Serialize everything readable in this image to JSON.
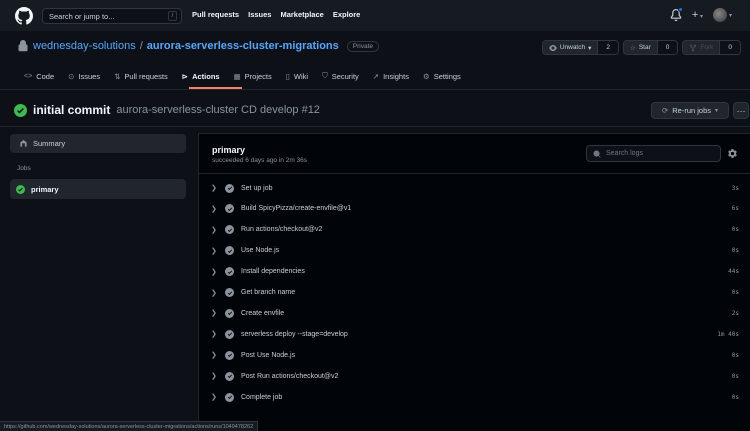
{
  "topbar": {
    "search_placeholder": "Search or jump to...",
    "search_shortcut": "/",
    "nav": [
      "Pull requests",
      "Issues",
      "Marketplace",
      "Explore"
    ]
  },
  "repo": {
    "owner": "wednesday-solutions",
    "separator": "/",
    "name": "aurora-serverless-cluster-migrations",
    "visibility": "Private",
    "unwatch_label": "Unwatch",
    "unwatch_count": "2",
    "star_label": "Star",
    "star_count": "0",
    "fork_label": "Fork",
    "fork_count": "0"
  },
  "tabs": [
    {
      "label": "Code",
      "icon": "code-icon"
    },
    {
      "label": "Issues",
      "icon": "issue-icon"
    },
    {
      "label": "Pull requests",
      "icon": "pull-request-icon"
    },
    {
      "label": "Actions",
      "icon": "play-icon"
    },
    {
      "label": "Projects",
      "icon": "project-icon"
    },
    {
      "label": "Wiki",
      "icon": "book-icon"
    },
    {
      "label": "Security",
      "icon": "shield-icon"
    },
    {
      "label": "Insights",
      "icon": "graph-icon"
    },
    {
      "label": "Settings",
      "icon": "gear-icon"
    }
  ],
  "run": {
    "title": "initial commit",
    "subtitle": "aurora-serverless-cluster CD develop #12",
    "rerun_label": "Re-run jobs",
    "kebab": "···"
  },
  "sidebar": {
    "summary_label": "Summary",
    "jobs_label": "Jobs",
    "job_name": "primary"
  },
  "job": {
    "title": "primary",
    "status_text": "succeeded 6 days ago in 2m 36s",
    "search_placeholder": "Search logs",
    "steps": [
      {
        "name": "Set up job",
        "duration": "3s"
      },
      {
        "name": "Build SpicyPizza/create-envfile@v1",
        "duration": "6s"
      },
      {
        "name": "Run actions/checkout@v2",
        "duration": "0s"
      },
      {
        "name": "Use Node.js",
        "duration": "0s"
      },
      {
        "name": "Install dependencies",
        "duration": "44s"
      },
      {
        "name": "Get branch name",
        "duration": "0s"
      },
      {
        "name": "Create envfile",
        "duration": "2s"
      },
      {
        "name": "serverless deploy --stage=develop",
        "duration": "1m 40s"
      },
      {
        "name": "Post Use Node.js",
        "duration": "0s"
      },
      {
        "name": "Post Run actions/checkout@v2",
        "duration": "0s"
      },
      {
        "name": "Complete job",
        "duration": "0s"
      }
    ]
  },
  "statusbar": {
    "url": "https://github.com/wednesday-solutions/aurora-serverless-cluster-migrations/actions/runs/1049478262"
  },
  "colors": {
    "background": "#0d1117",
    "header": "#161b22",
    "link": "#58a6ff",
    "success": "#3fb950",
    "active_tab_underline": "#f78166"
  }
}
